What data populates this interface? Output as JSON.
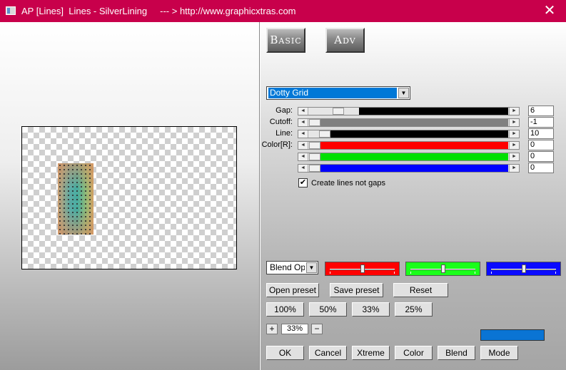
{
  "window": {
    "title": "AP [Lines]  Lines - SilverLining     --- > http://www.graphicxtras.com",
    "close_glyph": "✕",
    "titlebar_color": "#c8004b"
  },
  "tabs": {
    "basic": "Basic",
    "adv": "Adv"
  },
  "preset": {
    "selected": "Dotty Grid"
  },
  "sliders": [
    {
      "label": "Gap:",
      "value": "6",
      "fill": "#000000",
      "fill_from": 0.25
    },
    {
      "label": "Cutoff:",
      "value": "-1",
      "fill": "#808080",
      "fill_from": 0.0
    },
    {
      "label": "Line:",
      "value": "10",
      "fill": "#000000",
      "fill_from": 0.1
    },
    {
      "label": "Color[R]:",
      "value": "0",
      "fill": "#ff0000",
      "fill_from": 0.0
    },
    {
      "label": "",
      "value": "0",
      "fill": "#00e000",
      "fill_from": 0.0
    },
    {
      "label": "",
      "value": "0",
      "fill": "#0000ff",
      "fill_from": 0.0
    }
  ],
  "checkbox": {
    "label": "Create lines not gaps",
    "checked": true,
    "mark": "✔"
  },
  "blend": {
    "dropdown": "Blend Optio",
    "color_sliders": [
      {
        "name": "red",
        "color": "#ff0000",
        "level": 0.5
      },
      {
        "name": "green",
        "color": "#1aff1a",
        "level": 0.5
      },
      {
        "name": "blue",
        "color": "#0a0aff",
        "level": 0.5
      }
    ]
  },
  "buttons": {
    "open_preset": "Open preset",
    "save_preset": "Save preset",
    "reset": "Reset",
    "z100": "100%",
    "z50": "50%",
    "z33": "33%",
    "z25": "25%",
    "ok": "OK",
    "cancel": "Cancel",
    "xtreme": "Xtreme",
    "color": "Color",
    "blend": "Blend",
    "mode": "Mode"
  },
  "zoom": {
    "plus": "+",
    "minus": "−",
    "value": "33%"
  },
  "swatch": {
    "color": "#0a74d4"
  }
}
